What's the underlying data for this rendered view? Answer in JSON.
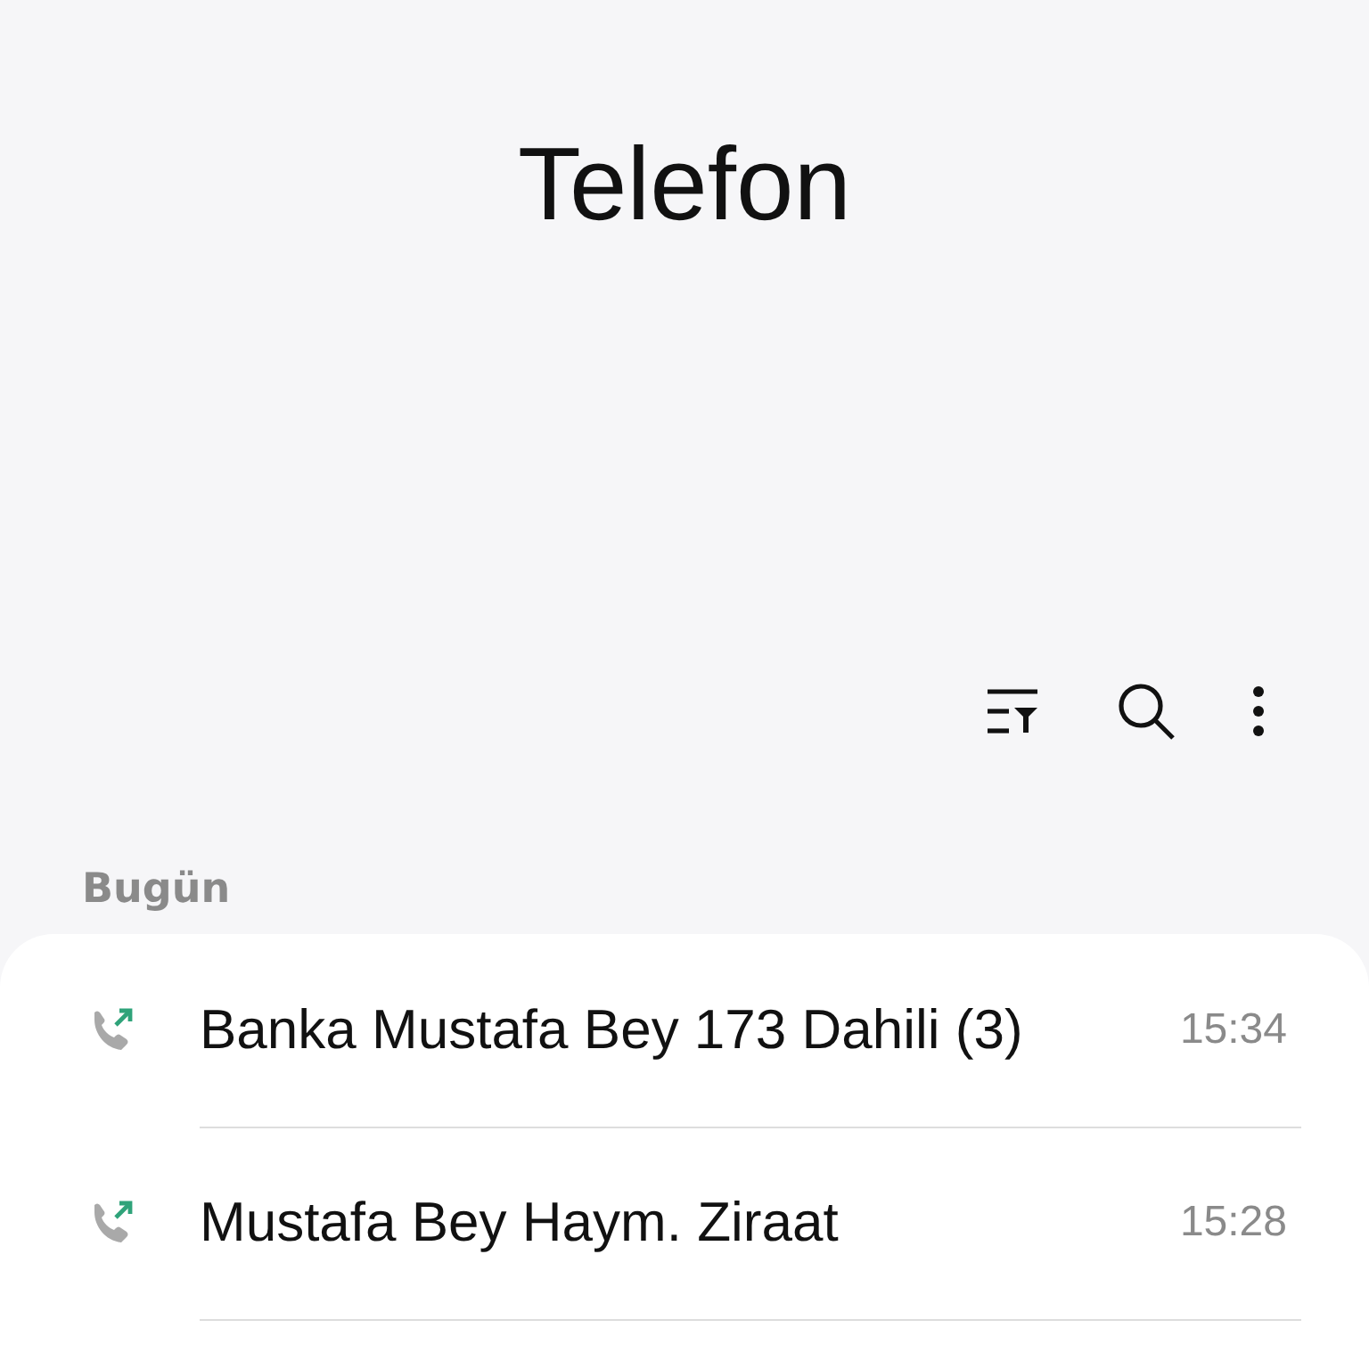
{
  "title": "Telefon",
  "section": "Bugün",
  "calls": [
    {
      "kind": "outgoing",
      "name": "Banka Mustafa Bey 173 Dahili (3)",
      "time": "15:34"
    },
    {
      "kind": "outgoing",
      "name": "Mustafa Bey Haym. Ziraat",
      "time": "15:28"
    }
  ]
}
